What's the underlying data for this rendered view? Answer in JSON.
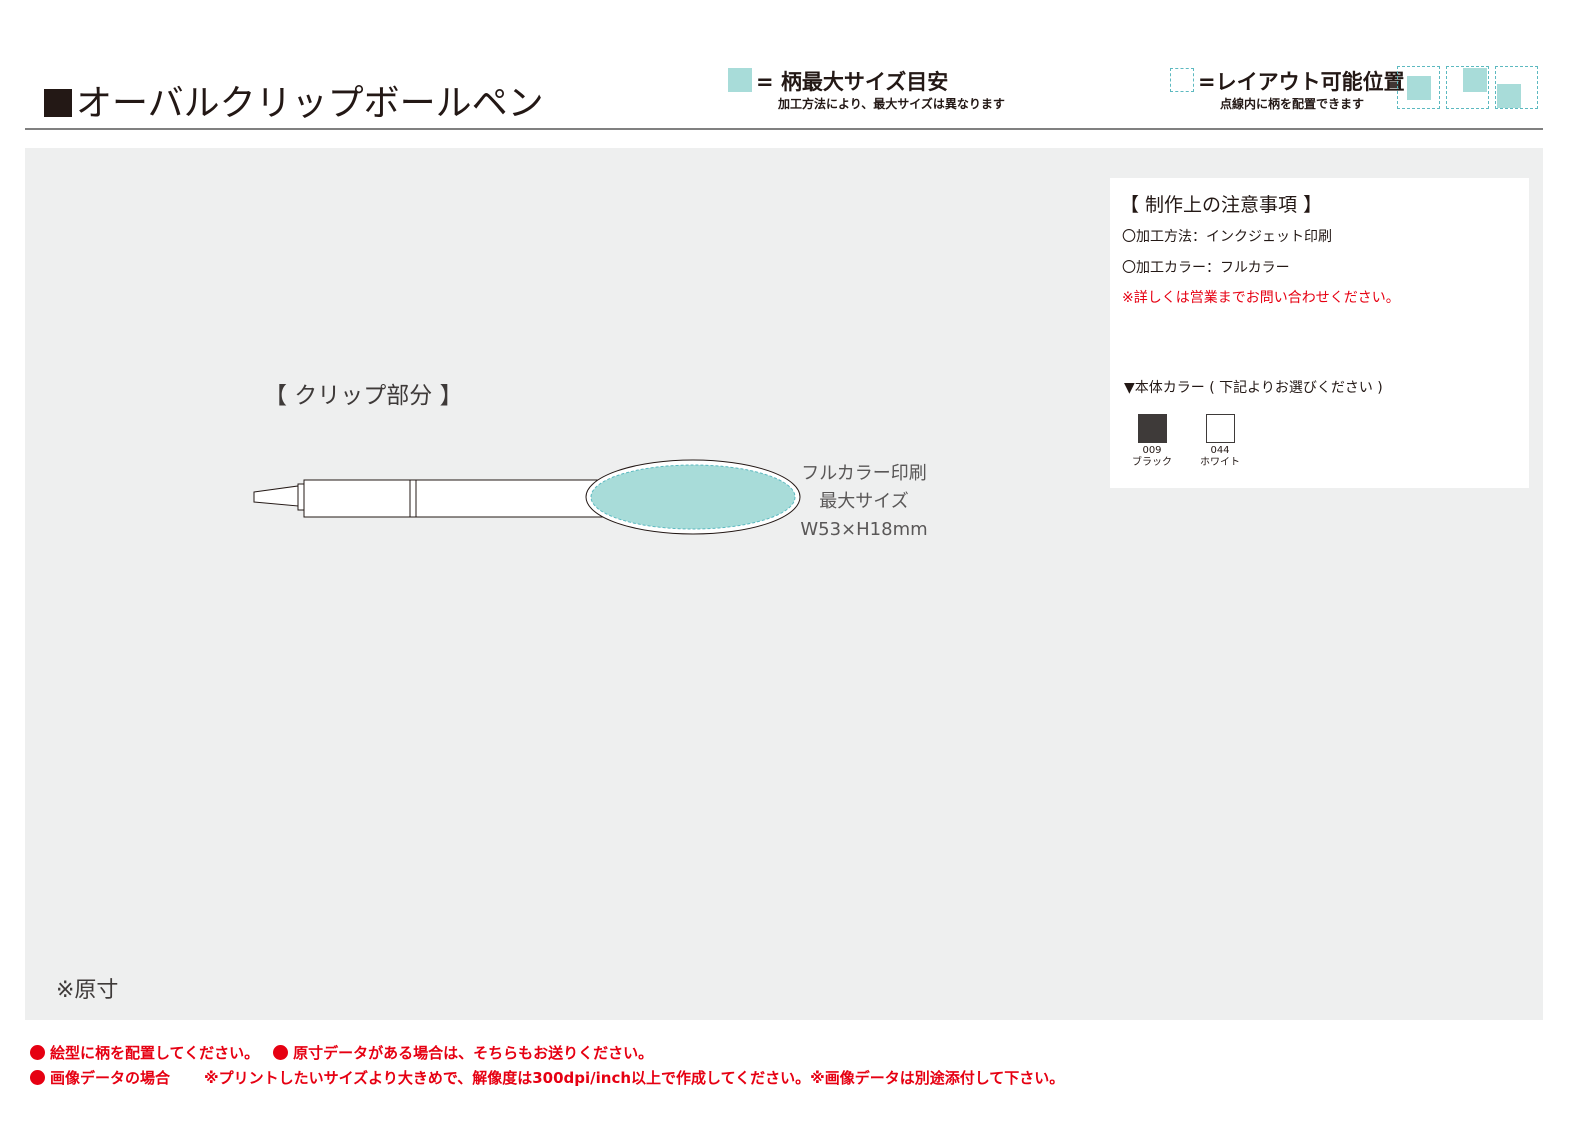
{
  "header": {
    "title": "オーバルクリップボールペン",
    "legend_max_size": {
      "label": "= 柄最大サイズ目安",
      "note": "加工方法により、最大サイズは異なります",
      "color": "#a8dcd9"
    },
    "legend_layout": {
      "label": "=レイアウト可能位置",
      "note": "点線内に柄を配置できます",
      "border_color": "#5cb9c0"
    }
  },
  "main": {
    "clip_label": "【 クリップ部分 】",
    "print_area": {
      "line1": "フルカラー印刷",
      "line2": "最大サイズ",
      "line3": "W53×H18mm"
    },
    "original_size_note": "※原寸"
  },
  "notes": {
    "title": "【 制作上の注意事項 】",
    "method": "〇加工方法：インクジェット印刷",
    "color": "〇加工カラー：フルカラー",
    "contact": "※詳しくは営業までお問い合わせください。",
    "body_color_title": "▼本体カラー ( 下記よりお選びください )",
    "body_colors": [
      {
        "code": "009",
        "name": "ブラック",
        "hex": "#3e3a39"
      },
      {
        "code": "044",
        "name": "ホワイト",
        "hex": "#ffffff"
      }
    ]
  },
  "footer": {
    "line1_a": "絵型に柄を配置してください。",
    "line1_b": "原寸データがある場合は、そちらもお送りください。",
    "line2_a": "画像データの場合",
    "line2_b": "※プリントしたいサイズより大きめで、解像度は300dpi/inch以上で作成してください。※画像データは別途添付して下さい。"
  },
  "colors": {
    "accent_red": "#e60012",
    "print_area_fill": "#a8dcd9",
    "background_panel": "#eeefef"
  }
}
